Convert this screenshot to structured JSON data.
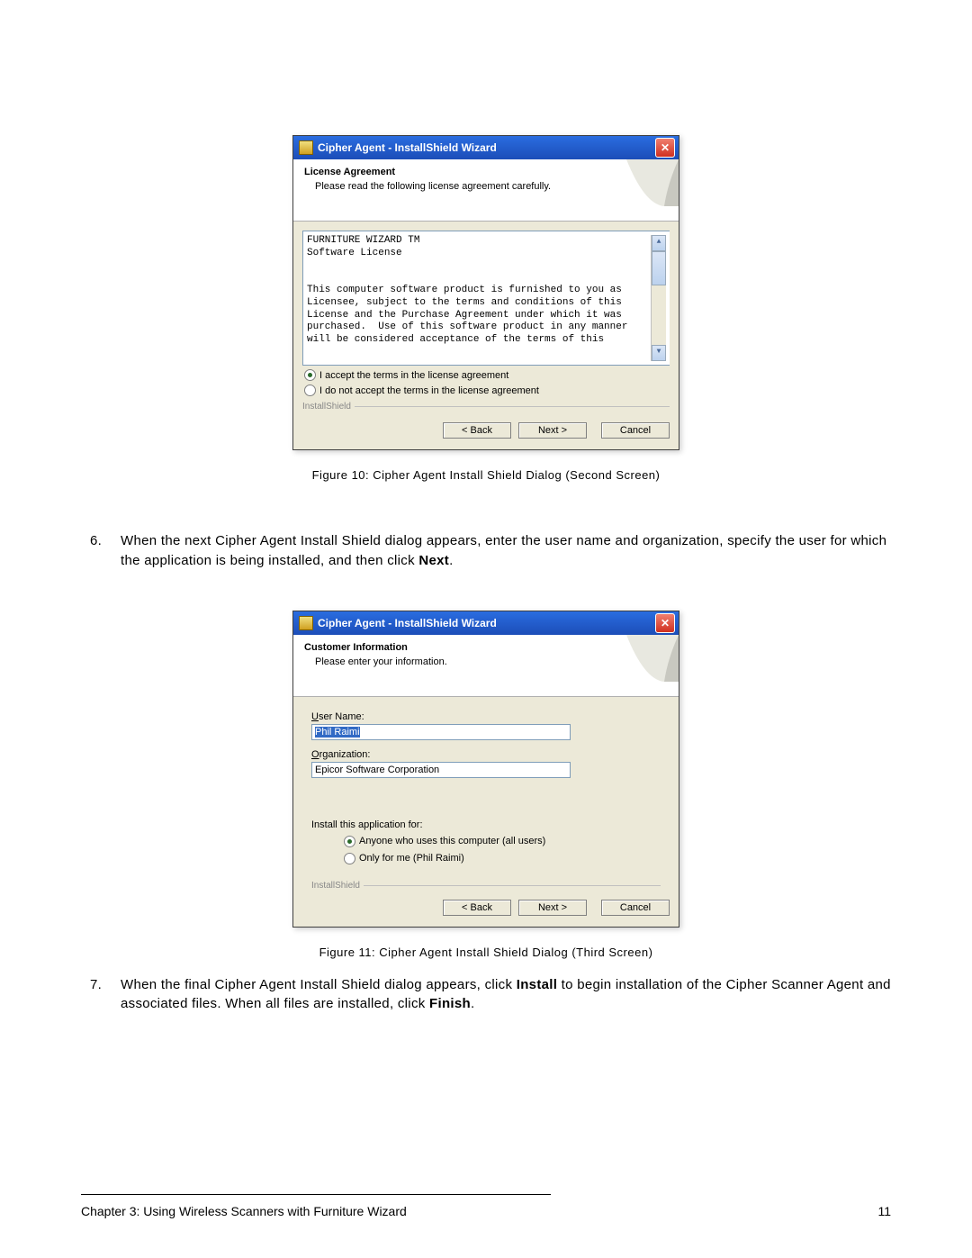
{
  "dialog1": {
    "title": "Cipher Agent - InstallShield Wizard",
    "heading": "License Agreement",
    "subheading": "Please read the following license agreement carefully.",
    "license_text": "FURNITURE WIZARD TM\nSoftware License\n\n\nThis computer software product is furnished to you as\nLicensee, subject to the terms and conditions of this\nLicense and the Purchase Agreement under which it was\npurchased.  Use of this software product in any manner\nwill be considered acceptance of the terms of this",
    "radio_accept": "I accept the terms in the license agreement",
    "radio_decline": "I do not accept the terms in the license agreement",
    "brand": "InstallShield",
    "back": "< Back",
    "next": "Next >",
    "cancel": "Cancel"
  },
  "caption1": "Figure 10: Cipher Agent Install Shield Dialog (Second Screen)",
  "step6": {
    "num": "6.",
    "text_a": "When the next Cipher Agent Install Shield dialog appears, enter the user name and organization, specify the user for which the application is being installed, and then click ",
    "text_b": "Next",
    "text_c": "."
  },
  "dialog2": {
    "title": "Cipher Agent - InstallShield Wizard",
    "heading": "Customer Information",
    "subheading": "Please enter your information.",
    "user_label_pre": "U",
    "user_label_post": "ser Name:",
    "user_value": "Phil Raimi",
    "org_label_pre": "O",
    "org_label_post": "rganization:",
    "org_value": "Epicor Software Corporation",
    "install_for": "Install this application for:",
    "radio_all_pre": "A",
    "radio_all_post": "nyone who uses this computer (all users)",
    "radio_me_pre": "Only for ",
    "radio_me_u": "m",
    "radio_me_post": "e (Phil Raimi)",
    "brand": "InstallShield",
    "back": "< Back",
    "next": "Next >",
    "cancel": "Cancel"
  },
  "caption2": "Figure 11: Cipher Agent Install Shield Dialog (Third Screen)",
  "step7": {
    "num": "7.",
    "text_a": "When the final Cipher Agent Install Shield dialog appears, click ",
    "text_b": "Install",
    "text_c": " to begin installation of the Cipher Scanner Agent and associated files. When all files are installed, click ",
    "text_d": "Finish",
    "text_e": "."
  },
  "footer": {
    "chapter": "Chapter 3: Using Wireless Scanners with Furniture Wizard",
    "page": "11"
  }
}
